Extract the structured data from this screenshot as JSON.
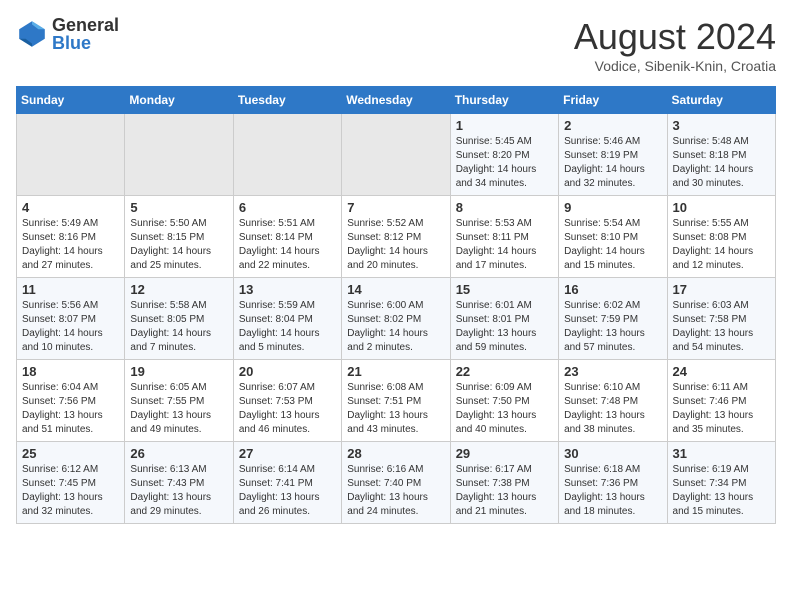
{
  "header": {
    "logo_general": "General",
    "logo_blue": "Blue",
    "title": "August 2024",
    "location": "Vodice, Sibenik-Knin, Croatia"
  },
  "weekdays": [
    "Sunday",
    "Monday",
    "Tuesday",
    "Wednesday",
    "Thursday",
    "Friday",
    "Saturday"
  ],
  "weeks": [
    [
      {
        "day": "",
        "content": ""
      },
      {
        "day": "",
        "content": ""
      },
      {
        "day": "",
        "content": ""
      },
      {
        "day": "",
        "content": ""
      },
      {
        "day": "1",
        "content": "Sunrise: 5:45 AM\nSunset: 8:20 PM\nDaylight: 14 hours\nand 34 minutes."
      },
      {
        "day": "2",
        "content": "Sunrise: 5:46 AM\nSunset: 8:19 PM\nDaylight: 14 hours\nand 32 minutes."
      },
      {
        "day": "3",
        "content": "Sunrise: 5:48 AM\nSunset: 8:18 PM\nDaylight: 14 hours\nand 30 minutes."
      }
    ],
    [
      {
        "day": "4",
        "content": "Sunrise: 5:49 AM\nSunset: 8:16 PM\nDaylight: 14 hours\nand 27 minutes."
      },
      {
        "day": "5",
        "content": "Sunrise: 5:50 AM\nSunset: 8:15 PM\nDaylight: 14 hours\nand 25 minutes."
      },
      {
        "day": "6",
        "content": "Sunrise: 5:51 AM\nSunset: 8:14 PM\nDaylight: 14 hours\nand 22 minutes."
      },
      {
        "day": "7",
        "content": "Sunrise: 5:52 AM\nSunset: 8:12 PM\nDaylight: 14 hours\nand 20 minutes."
      },
      {
        "day": "8",
        "content": "Sunrise: 5:53 AM\nSunset: 8:11 PM\nDaylight: 14 hours\nand 17 minutes."
      },
      {
        "day": "9",
        "content": "Sunrise: 5:54 AM\nSunset: 8:10 PM\nDaylight: 14 hours\nand 15 minutes."
      },
      {
        "day": "10",
        "content": "Sunrise: 5:55 AM\nSunset: 8:08 PM\nDaylight: 14 hours\nand 12 minutes."
      }
    ],
    [
      {
        "day": "11",
        "content": "Sunrise: 5:56 AM\nSunset: 8:07 PM\nDaylight: 14 hours\nand 10 minutes."
      },
      {
        "day": "12",
        "content": "Sunrise: 5:58 AM\nSunset: 8:05 PM\nDaylight: 14 hours\nand 7 minutes."
      },
      {
        "day": "13",
        "content": "Sunrise: 5:59 AM\nSunset: 8:04 PM\nDaylight: 14 hours\nand 5 minutes."
      },
      {
        "day": "14",
        "content": "Sunrise: 6:00 AM\nSunset: 8:02 PM\nDaylight: 14 hours\nand 2 minutes."
      },
      {
        "day": "15",
        "content": "Sunrise: 6:01 AM\nSunset: 8:01 PM\nDaylight: 13 hours\nand 59 minutes."
      },
      {
        "day": "16",
        "content": "Sunrise: 6:02 AM\nSunset: 7:59 PM\nDaylight: 13 hours\nand 57 minutes."
      },
      {
        "day": "17",
        "content": "Sunrise: 6:03 AM\nSunset: 7:58 PM\nDaylight: 13 hours\nand 54 minutes."
      }
    ],
    [
      {
        "day": "18",
        "content": "Sunrise: 6:04 AM\nSunset: 7:56 PM\nDaylight: 13 hours\nand 51 minutes."
      },
      {
        "day": "19",
        "content": "Sunrise: 6:05 AM\nSunset: 7:55 PM\nDaylight: 13 hours\nand 49 minutes."
      },
      {
        "day": "20",
        "content": "Sunrise: 6:07 AM\nSunset: 7:53 PM\nDaylight: 13 hours\nand 46 minutes."
      },
      {
        "day": "21",
        "content": "Sunrise: 6:08 AM\nSunset: 7:51 PM\nDaylight: 13 hours\nand 43 minutes."
      },
      {
        "day": "22",
        "content": "Sunrise: 6:09 AM\nSunset: 7:50 PM\nDaylight: 13 hours\nand 40 minutes."
      },
      {
        "day": "23",
        "content": "Sunrise: 6:10 AM\nSunset: 7:48 PM\nDaylight: 13 hours\nand 38 minutes."
      },
      {
        "day": "24",
        "content": "Sunrise: 6:11 AM\nSunset: 7:46 PM\nDaylight: 13 hours\nand 35 minutes."
      }
    ],
    [
      {
        "day": "25",
        "content": "Sunrise: 6:12 AM\nSunset: 7:45 PM\nDaylight: 13 hours\nand 32 minutes."
      },
      {
        "day": "26",
        "content": "Sunrise: 6:13 AM\nSunset: 7:43 PM\nDaylight: 13 hours\nand 29 minutes."
      },
      {
        "day": "27",
        "content": "Sunrise: 6:14 AM\nSunset: 7:41 PM\nDaylight: 13 hours\nand 26 minutes."
      },
      {
        "day": "28",
        "content": "Sunrise: 6:16 AM\nSunset: 7:40 PM\nDaylight: 13 hours\nand 24 minutes."
      },
      {
        "day": "29",
        "content": "Sunrise: 6:17 AM\nSunset: 7:38 PM\nDaylight: 13 hours\nand 21 minutes."
      },
      {
        "day": "30",
        "content": "Sunrise: 6:18 AM\nSunset: 7:36 PM\nDaylight: 13 hours\nand 18 minutes."
      },
      {
        "day": "31",
        "content": "Sunrise: 6:19 AM\nSunset: 7:34 PM\nDaylight: 13 hours\nand 15 minutes."
      }
    ]
  ]
}
